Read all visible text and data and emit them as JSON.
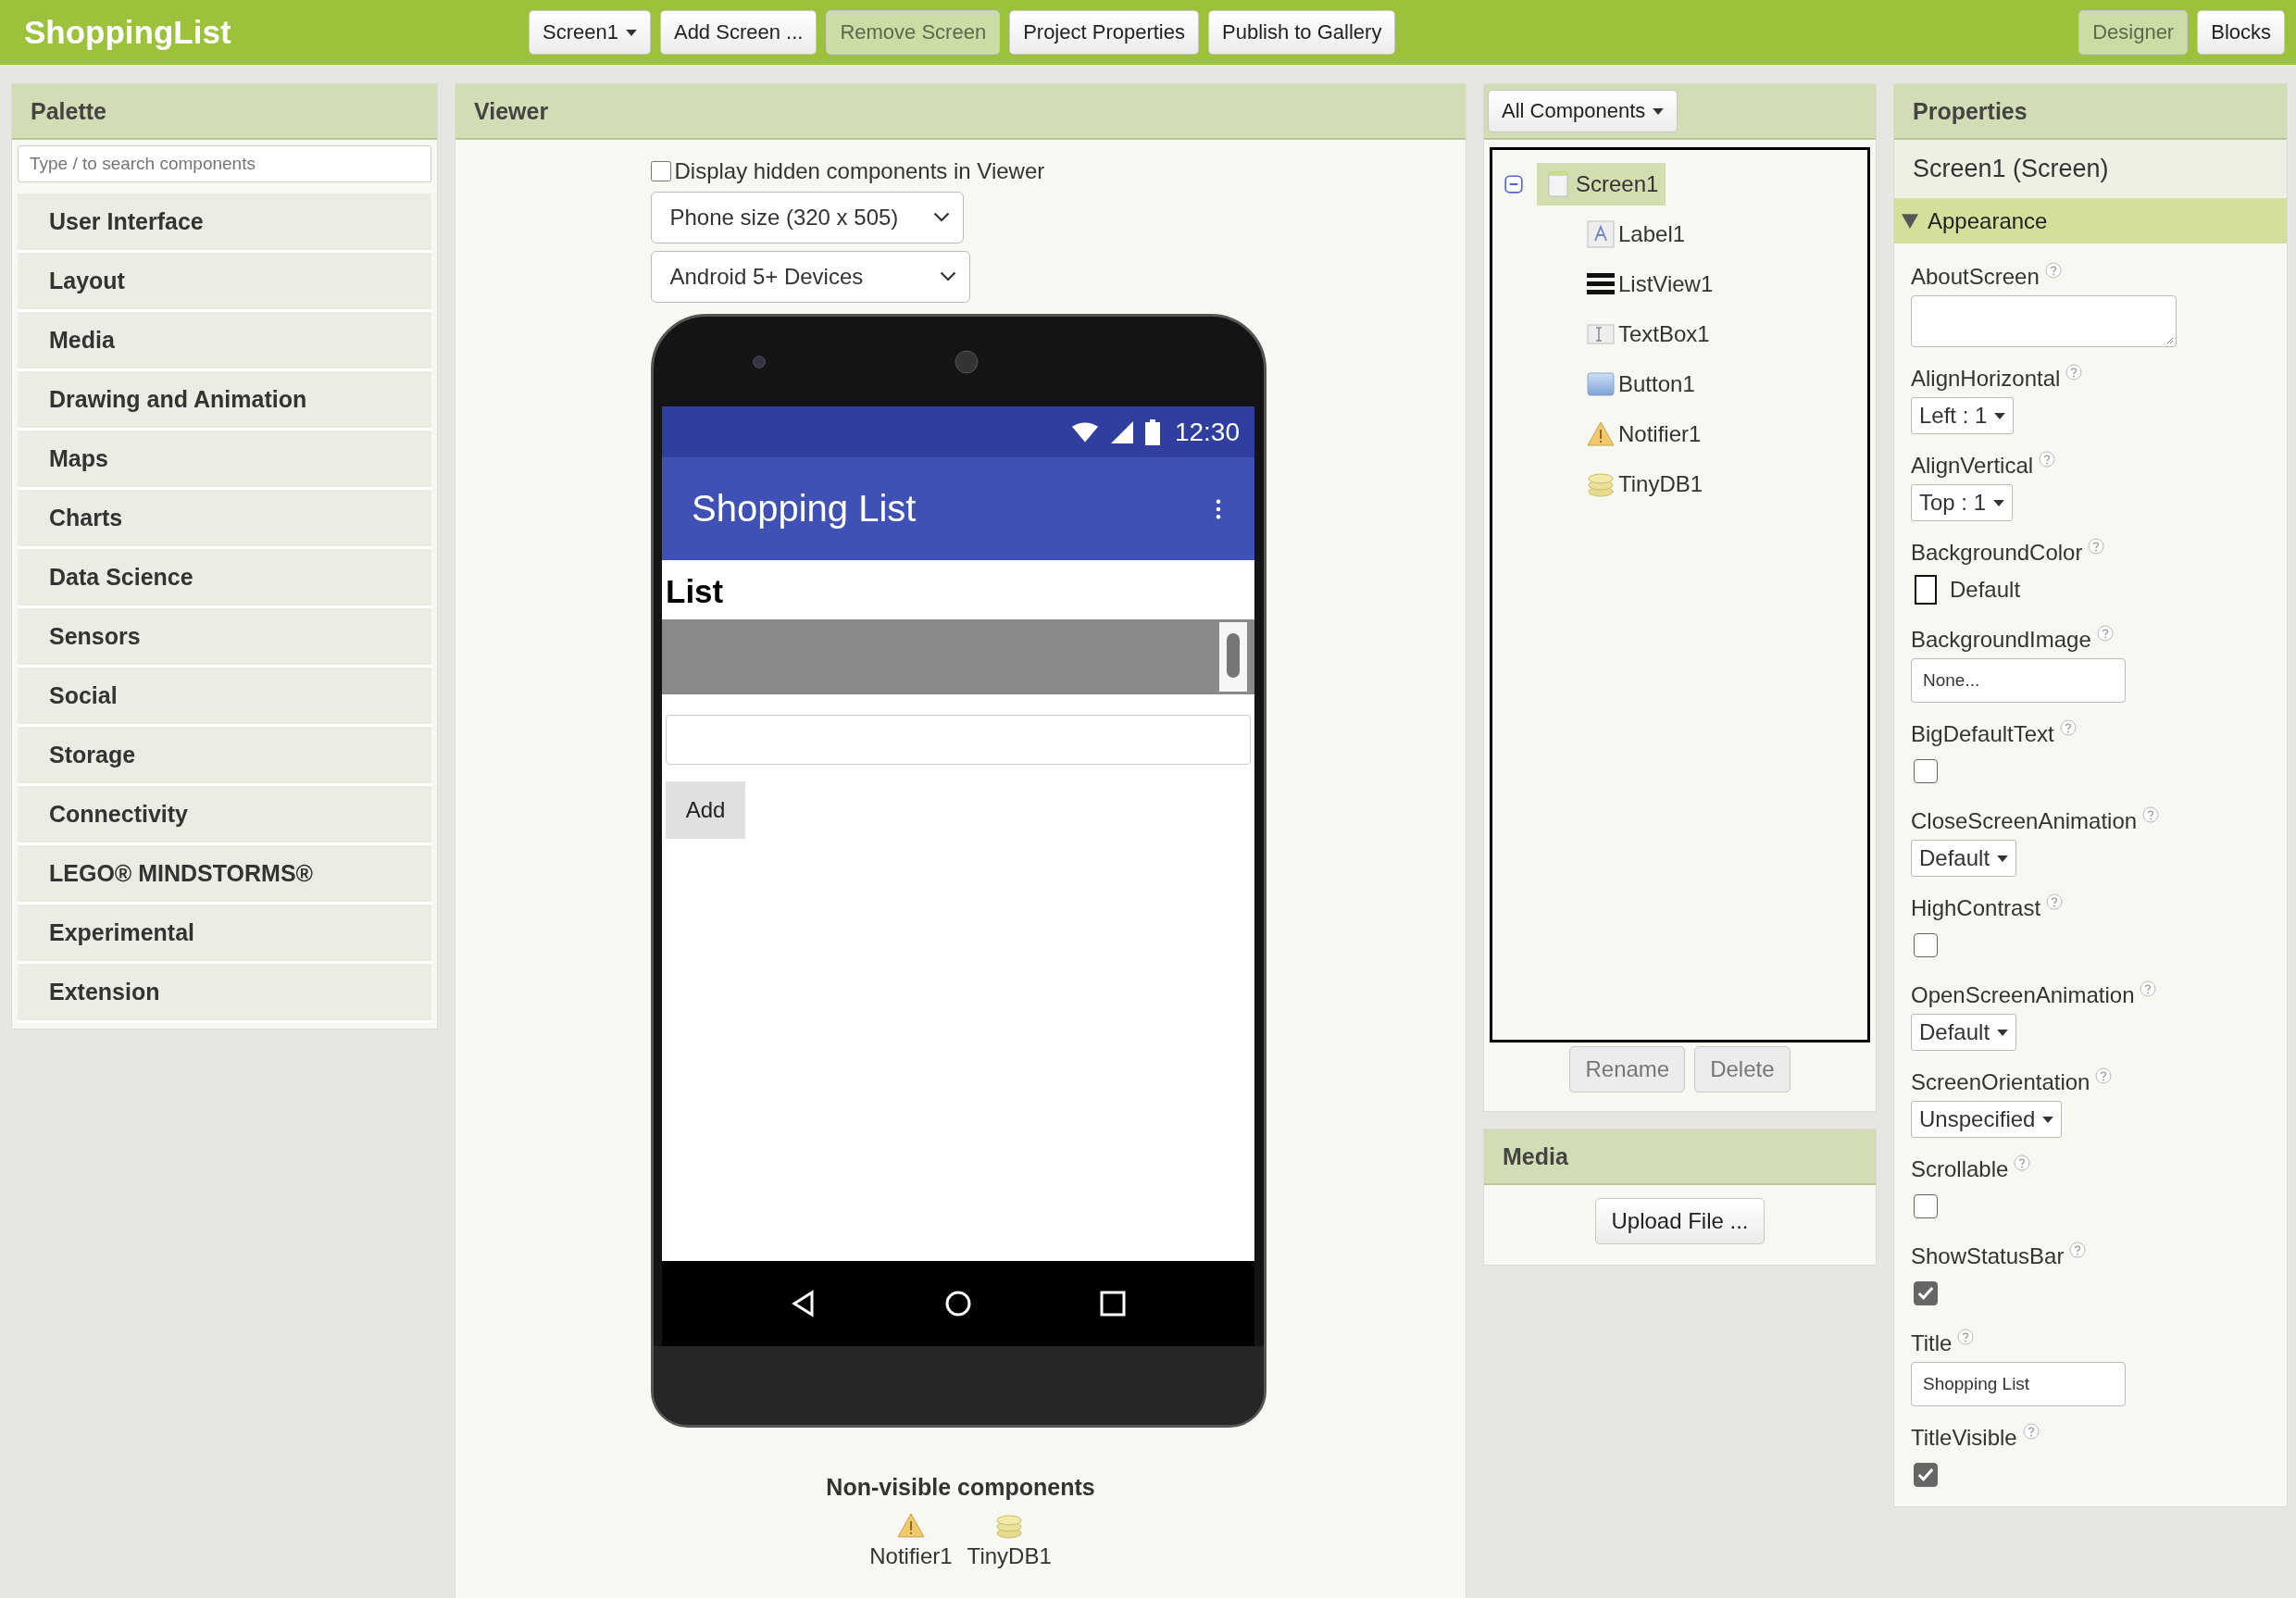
{
  "app_title": "ShoppingList",
  "toolbar": [
    {
      "label": "Screen1",
      "kind": "dropdown",
      "disabled": false
    },
    {
      "label": "Add Screen ...",
      "kind": "button",
      "disabled": false
    },
    {
      "label": "Remove Screen",
      "kind": "button",
      "disabled": true
    },
    {
      "label": "Project Properties",
      "kind": "button",
      "disabled": false
    },
    {
      "label": "Publish to Gallery",
      "kind": "button",
      "disabled": false
    }
  ],
  "view_switch": [
    {
      "label": "Designer",
      "selected": true
    },
    {
      "label": "Blocks",
      "selected": false
    }
  ],
  "palette": {
    "title": "Palette",
    "search": {
      "placeholder": "Type / to search components"
    },
    "categories": [
      "User Interface",
      "Layout",
      "Media",
      "Drawing and Animation",
      "Maps",
      "Charts",
      "Data Science",
      "Sensors",
      "Social",
      "Storage",
      "Connectivity",
      "LEGO® MINDSTORMS®",
      "Experimental",
      "Extension"
    ]
  },
  "viewer": {
    "title": "Viewer",
    "hidden_checkbox": {
      "label": "Display hidden components in Viewer",
      "checked": false
    },
    "size_select": "Phone size (320 x 505)",
    "device_select": "Android 5+ Devices",
    "phone": {
      "status_time": "12:30",
      "title": "Shopping List",
      "label": "List",
      "button": "Add"
    },
    "nonvisible": {
      "title": "Non-visible components",
      "items": [
        {
          "name": "Notifier1",
          "kind": "notifier"
        },
        {
          "name": "TinyDB1",
          "kind": "tinydb"
        }
      ]
    }
  },
  "components": {
    "filter": "All Components",
    "tree": [
      {
        "name": "Screen1",
        "kind": "screen",
        "selected": true,
        "expanded": true,
        "children": [
          {
            "name": "Label1",
            "kind": "label",
            "selected": false
          },
          {
            "name": "ListView1",
            "kind": "listview",
            "selected": false
          },
          {
            "name": "TextBox1",
            "kind": "textbox",
            "selected": false
          },
          {
            "name": "Button1",
            "kind": "button",
            "selected": false
          },
          {
            "name": "Notifier1",
            "kind": "notifier",
            "selected": false
          },
          {
            "name": "TinyDB1",
            "kind": "tinydb",
            "selected": false
          }
        ]
      }
    ],
    "buttons": [
      {
        "label": "Rename",
        "disabled": true
      },
      {
        "label": "Delete",
        "disabled": true
      }
    ]
  },
  "media": {
    "title": "Media",
    "upload": "Upload File ..."
  },
  "properties": {
    "title": "Properties",
    "subject": "Screen1 (Screen)",
    "group": {
      "label": "Appearance",
      "expanded": true
    },
    "items": [
      {
        "name": "AboutScreen",
        "kind": "textarea"
      },
      {
        "name": "AlignHorizontal",
        "kind": "dropdown",
        "value": "Left : 1"
      },
      {
        "name": "AlignVertical",
        "kind": "dropdown",
        "value": "Top : 1"
      },
      {
        "name": "BackgroundColor",
        "kind": "color",
        "value": "Default"
      },
      {
        "name": "BackgroundImage",
        "kind": "text",
        "value": "None..."
      },
      {
        "name": "BigDefaultText",
        "kind": "checkbox",
        "checked": false
      },
      {
        "name": "CloseScreenAnimation",
        "kind": "dropdown",
        "value": "Default"
      },
      {
        "name": "HighContrast",
        "kind": "checkbox",
        "checked": false
      },
      {
        "name": "OpenScreenAnimation",
        "kind": "dropdown",
        "value": "Default"
      },
      {
        "name": "ScreenOrientation",
        "kind": "dropdown",
        "value": "Unspecified"
      },
      {
        "name": "Scrollable",
        "kind": "checkbox",
        "checked": false
      },
      {
        "name": "ShowStatusBar",
        "kind": "checkbox",
        "checked": true
      },
      {
        "name": "Title",
        "kind": "text",
        "value": "Shopping List"
      },
      {
        "name": "TitleVisible",
        "kind": "checkbox",
        "checked": true
      }
    ]
  }
}
